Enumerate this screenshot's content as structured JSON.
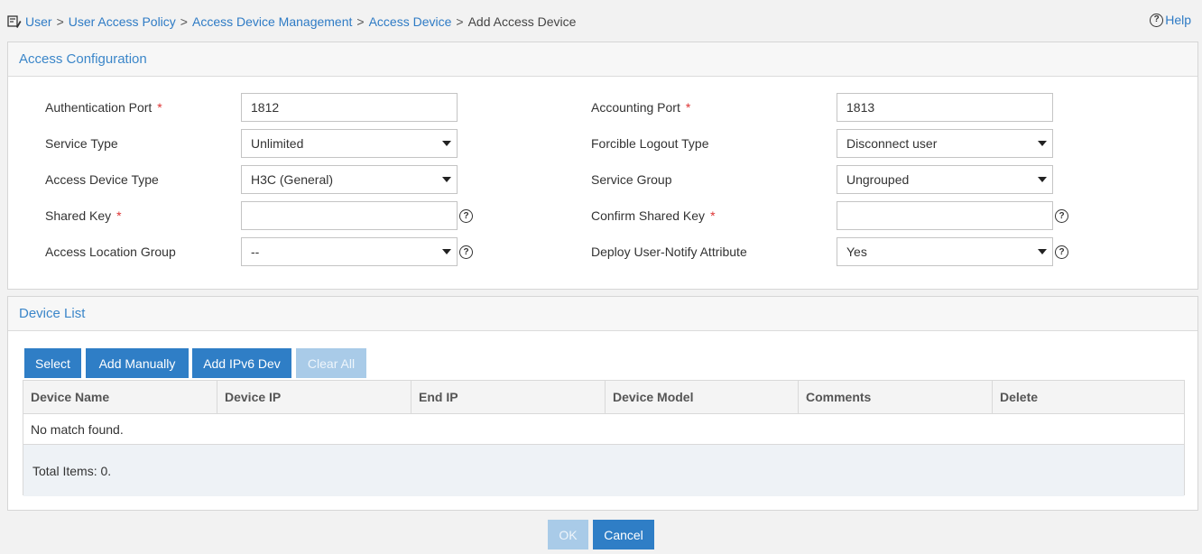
{
  "breadcrumb": {
    "items": [
      "User",
      "User Access Policy",
      "Access Device Management",
      "Access Device"
    ],
    "separator": ">",
    "current": "Add Access Device"
  },
  "help_label": "Help",
  "access_config": {
    "title": "Access Configuration",
    "fields": {
      "auth_port": {
        "label": "Authentication Port",
        "required": "*",
        "value": "1812"
      },
      "acct_port": {
        "label": "Accounting Port",
        "required": "*",
        "value": "1813"
      },
      "service_type": {
        "label": "Service Type",
        "value": "Unlimited"
      },
      "forcible_logout": {
        "label": "Forcible Logout Type",
        "value": "Disconnect user"
      },
      "device_type": {
        "label": "Access Device Type",
        "value": "H3C (General)"
      },
      "service_group": {
        "label": "Service Group",
        "value": "Ungrouped"
      },
      "shared_key": {
        "label": "Shared Key",
        "required": "*",
        "value": ""
      },
      "confirm_key": {
        "label": "Confirm Shared Key",
        "required": "*",
        "value": ""
      },
      "location_group": {
        "label": "Access Location Group",
        "value": "--"
      },
      "user_notify": {
        "label": "Deploy User-Notify Attribute",
        "value": "Yes"
      }
    }
  },
  "device_list": {
    "title": "Device List",
    "buttons": {
      "select": "Select",
      "add_manually": "Add Manually",
      "add_ipv6": "Add IPv6 Dev",
      "clear_all": "Clear All"
    },
    "columns": [
      "Device Name",
      "Device IP",
      "End IP",
      "Device Model",
      "Comments",
      "Delete"
    ],
    "empty_message": "No match found.",
    "total_items": "Total Items: 0."
  },
  "footer": {
    "ok": "OK",
    "cancel": "Cancel"
  },
  "colors": {
    "accent": "#2f7ec6",
    "link": "#2e7bc5",
    "required": "#d33"
  }
}
